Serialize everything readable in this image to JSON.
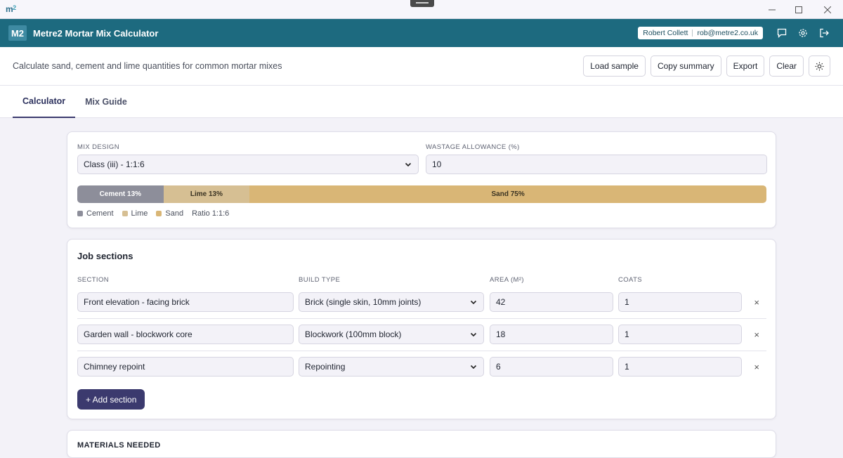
{
  "window": {
    "logo": "m",
    "logo_sup": "2"
  },
  "app": {
    "badge": "M2",
    "title": "Metre2 Mortar Mix Calculator",
    "user_name": "Robert Collett",
    "user_email": "rob@metre2.co.uk"
  },
  "subbar": {
    "description": "Calculate sand, cement and lime quantities for common mortar mixes",
    "actions": [
      "Load sample",
      "Copy summary",
      "Export",
      "Clear"
    ]
  },
  "tabs": [
    "Calculator",
    "Mix Guide"
  ],
  "mix": {
    "design_label": "MIX DESIGN",
    "design_value": "Class (iii) - 1:1:6",
    "wastage_label": "WASTAGE ALLOWANCE (%)",
    "wastage_value": "10",
    "segments": [
      {
        "label": "Cement 13%",
        "percent": 12.5,
        "color": "#8d8e9a",
        "text_color": "#ffffff"
      },
      {
        "label": "Lime 13%",
        "percent": 12.5,
        "color": "#d6bf93",
        "text_color": "#3a3322"
      },
      {
        "label": "Sand 75%",
        "percent": 75,
        "color": "#d9b676",
        "text_color": "#3a3322"
      }
    ],
    "legend": [
      {
        "label": "Cement",
        "color": "#8d8e9a"
      },
      {
        "label": "Lime",
        "color": "#d6bf93"
      },
      {
        "label": "Sand",
        "color": "#d9b676"
      }
    ],
    "ratio": "Ratio 1:1:6"
  },
  "job": {
    "title": "Job sections",
    "headers": [
      "SECTION",
      "BUILD TYPE",
      "AREA (M²)",
      "COATS"
    ],
    "rows": [
      {
        "section": "Front elevation - facing brick",
        "build_type": "Brick (single skin, 10mm joints)",
        "area": "42",
        "coats": "1"
      },
      {
        "section": "Garden wall - blockwork core",
        "build_type": "Blockwork (100mm block)",
        "area": "18",
        "coats": "1"
      },
      {
        "section": "Chimney repoint",
        "build_type": "Repointing",
        "area": "6",
        "coats": "1"
      }
    ],
    "remove_glyph": "×",
    "add_label": "+ Add section"
  },
  "materials": {
    "title": "MATERIALS NEEDED"
  }
}
